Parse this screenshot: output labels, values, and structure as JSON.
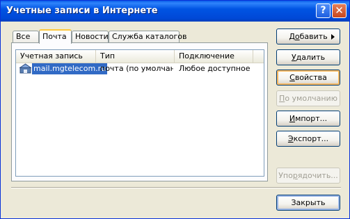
{
  "window": {
    "title": "Учетные записи в Интернете",
    "help_label": "?",
    "close_label": "✕"
  },
  "tabs": [
    {
      "label": "Все",
      "active": false
    },
    {
      "label": "Почта",
      "active": true
    },
    {
      "label": "Новости",
      "active": false
    },
    {
      "label": "Служба каталогов",
      "active": false
    }
  ],
  "list": {
    "columns": [
      "Учетная запись",
      "Тип",
      "Подключение"
    ],
    "rows": [
      {
        "account": "mail.mgtelecom.ru",
        "type": "почта (по умолчан...",
        "connection": "Любое доступное",
        "selected": true,
        "icon": "mail-account-icon"
      }
    ]
  },
  "buttons": {
    "add": {
      "label_pre": "Д",
      "label_u": "о",
      "label_post": "бавить"
    },
    "delete": {
      "label_pre": "",
      "label_u": "У",
      "label_post": "далить"
    },
    "properties": {
      "label_pre": "",
      "label_u": "С",
      "label_post": "войства"
    },
    "set_default": {
      "label_pre": "",
      "label_u": "П",
      "label_post": "о умолчанию"
    },
    "import": {
      "label_pre": "",
      "label_u": "И",
      "label_post": "мпорт..."
    },
    "export": {
      "label_pre": "",
      "label_u": "Э",
      "label_post": "кспорт..."
    },
    "order": {
      "label_pre": "Упо",
      "label_u": "р",
      "label_post": "ядочить..."
    },
    "close": {
      "label": "Закрыть"
    }
  },
  "colors": {
    "title_bar": "#0054e3",
    "selection": "#316ac5",
    "focus_ring": "#f9b85e"
  }
}
